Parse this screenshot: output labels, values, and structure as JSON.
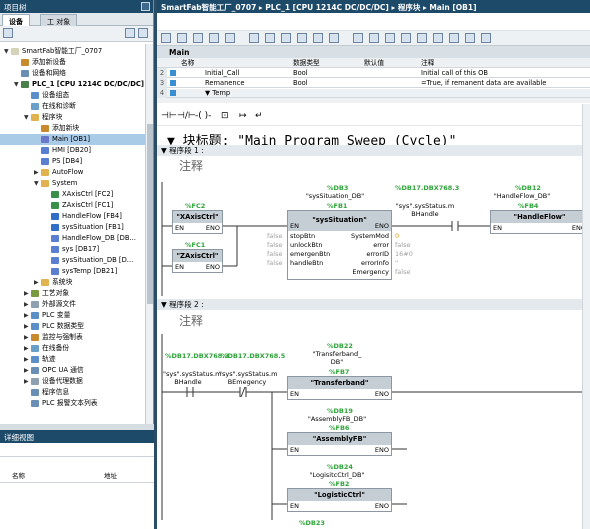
{
  "left": {
    "title": "项目树",
    "tabs": [
      "设备",
      "工 对象"
    ],
    "detail_title": "详细视图",
    "detail_cols": [
      "名称",
      "地址"
    ],
    "tree": [
      {
        "label": "SmartFab智能工厂_0707",
        "indent": 0,
        "arrow": "▼",
        "color": "#d6d2b8"
      },
      {
        "label": "添加新设备",
        "indent": 1,
        "arrow": "",
        "color": "#c88a2d"
      },
      {
        "label": "设备和网络",
        "indent": 1,
        "arrow": "",
        "color": "#6a8fb5"
      },
      {
        "label": "PLC_1 [CPU 1214C DC/DC/DC]",
        "indent": 1,
        "arrow": "▼",
        "color": "#4a7f4a",
        "bold": true
      },
      {
        "label": "设备组态",
        "indent": 2,
        "arrow": "",
        "color": "#5b8fc7"
      },
      {
        "label": "在线和诊断",
        "indent": 2,
        "arrow": "",
        "color": "#6aa0c8"
      },
      {
        "label": "程序块",
        "indent": 2,
        "arrow": "▼",
        "color": "#e0b34f"
      },
      {
        "label": "添加新块",
        "indent": 3,
        "arrow": "",
        "color": "#c88a2d"
      },
      {
        "label": "Main [OB1]",
        "indent": 3,
        "arrow": "",
        "color": "#6a76c8",
        "sel": true
      },
      {
        "label": "HMI [DB20]",
        "indent": 3,
        "arrow": "",
        "color": "#5a7fd0"
      },
      {
        "label": "PS [DB4]",
        "indent": 3,
        "arrow": "",
        "color": "#5a7fd0"
      },
      {
        "label": "AutoFlow",
        "indent": 3,
        "arrow": "▶",
        "color": "#e0b34f"
      },
      {
        "label": "System",
        "indent": 3,
        "arrow": "▼",
        "color": "#e0b34f"
      },
      {
        "label": "XAxisCtrl [FC2]",
        "indent": 4,
        "arrow": "",
        "color": "#3a8f4a"
      },
      {
        "label": "ZAxisCtrl [FC1]",
        "indent": 4,
        "arrow": "",
        "color": "#3a8f4a"
      },
      {
        "label": "HandleFlow [FB4]",
        "indent": 4,
        "arrow": "",
        "color": "#2f6fc8"
      },
      {
        "label": "sysSituation [FB1]",
        "indent": 4,
        "arrow": "",
        "color": "#2f6fc8"
      },
      {
        "label": "HandleFlow_DB [DB...",
        "indent": 4,
        "arrow": "",
        "color": "#5a7fd0"
      },
      {
        "label": "sys [DB17]",
        "indent": 4,
        "arrow": "",
        "color": "#5a7fd0"
      },
      {
        "label": "sysSituation_DB [D...",
        "indent": 4,
        "arrow": "",
        "color": "#5a7fd0"
      },
      {
        "label": "sysTemp [DB21]",
        "indent": 4,
        "arrow": "",
        "color": "#5a7fd0"
      },
      {
        "label": "系统块",
        "indent": 3,
        "arrow": "▶",
        "color": "#e0b34f"
      },
      {
        "label": "工艺对象",
        "indent": 2,
        "arrow": "▶",
        "color": "#7a9a3f"
      },
      {
        "label": "外部源文件",
        "indent": 2,
        "arrow": "▶",
        "color": "#8fa0b0"
      },
      {
        "label": "PLC 变量",
        "indent": 2,
        "arrow": "▶",
        "color": "#5b8fc7"
      },
      {
        "label": "PLC 数据类型",
        "indent": 2,
        "arrow": "▶",
        "color": "#5b8fc7"
      },
      {
        "label": "监控与强制表",
        "indent": 2,
        "arrow": "▶",
        "color": "#c88a2d"
      },
      {
        "label": "在线备份",
        "indent": 2,
        "arrow": "▶",
        "color": "#6aa0c8"
      },
      {
        "label": "轨迹",
        "indent": 2,
        "arrow": "▶",
        "color": "#5b8fc7"
      },
      {
        "label": "OPC UA 通信",
        "indent": 2,
        "arrow": "▶",
        "color": "#6a8fb5"
      },
      {
        "label": "设备代理数据",
        "indent": 2,
        "arrow": "▶",
        "color": "#8fa0b0"
      },
      {
        "label": "程序信息",
        "indent": 2,
        "arrow": "",
        "color": "#6a8fb5"
      },
      {
        "label": "PLC 报警文本列表",
        "indent": 2,
        "arrow": "",
        "color": "#6a8fb5"
      }
    ]
  },
  "right": {
    "breadcrumb": "SmartFab智能工厂_0707  ▸  PLC_1 [CPU 1214C DC/DC/DC]  ▸  程序块  ▸  Main [OB1]",
    "block_name": "Main",
    "iface_header": {
      "name": "名称",
      "type": "数据类型",
      "default": "默认值",
      "comment": "注释"
    },
    "iface_rows": [
      {
        "num": "2",
        "name": "Initial_Call",
        "type": "Bool",
        "comment": "Initial call of this OB"
      },
      {
        "num": "3",
        "name": "Remanence",
        "type": "Bool",
        "comment": "=True, if remanent data are available"
      },
      {
        "num": "4",
        "name": "▼ Temp",
        "type": "",
        "comment": ""
      }
    ],
    "block_title": "▼ 块标题:  \"Main Program Sweep (Cycle)\"",
    "network1": {
      "head": "▼    程序段 1 :",
      "comment": "注释"
    },
    "network2": {
      "head": "▼    程序段 2 :",
      "comment": "注释"
    },
    "n1": {
      "fc2_num": "%FC2",
      "fc2_name": "\"XAxisCtrl\"",
      "fc1_num": "%FC1",
      "fc1_name": "\"ZAxisCtrl\"",
      "db3": "%DB3",
      "db3_name": "\"sysSituation_DB\"",
      "fb1_num": "%FB1",
      "fb1_name": "\"sysSituation\"",
      "contact_addr": "%DB17.DBX768.3",
      "contact_sym": "\"sys\".sysStatus.m\nBHandle",
      "db12": "%DB12",
      "db12_name": "\"HandleFlow_DB\"",
      "fb4_num": "%FB4",
      "fb4_name": "\"HandleFlow\"",
      "en": "EN",
      "eno": "ENO",
      "fb1_inputs": [
        "stopBtn",
        "unlockBtn",
        "emergenBtn",
        "handleBtn"
      ],
      "fb1_input_vals": [
        "false",
        "false",
        "false",
        "false"
      ],
      "fb1_outputs": [
        "SystemMod",
        "error",
        "errorID",
        "errorInfo",
        "Emergency"
      ],
      "fb1_output_vals": [
        "0",
        "false",
        "16#0",
        "''",
        "false"
      ]
    },
    "n2": {
      "c1_addr": "%DB17.DBX768.3",
      "c1_sym": "\"sys\".sysStatus.m\nBHandle",
      "c2_addr": "%DB17.DBX768.5",
      "c2_sym": "\"sys\".sysStatus.m\nBEmegency",
      "db22": "%DB22",
      "db22_name": "\"Transferband_\nDB\"",
      "fb7_num": "%FB7",
      "fb7_name": "\"Transferband\"",
      "db19": "%DB19",
      "db19_name": "\"AssemblyFB_DB\"",
      "fb6_num": "%FB6",
      "fb6_name": "\"AssemblyFB\"",
      "db24": "%DB24",
      "db24_name": "\"LogisitcCtrl_DB\"",
      "fb2_num": "%FB2",
      "fb2_name": "\"LogisticCtrl\"",
      "db23": "%DB23",
      "en": "EN",
      "eno": "ENO"
    }
  }
}
